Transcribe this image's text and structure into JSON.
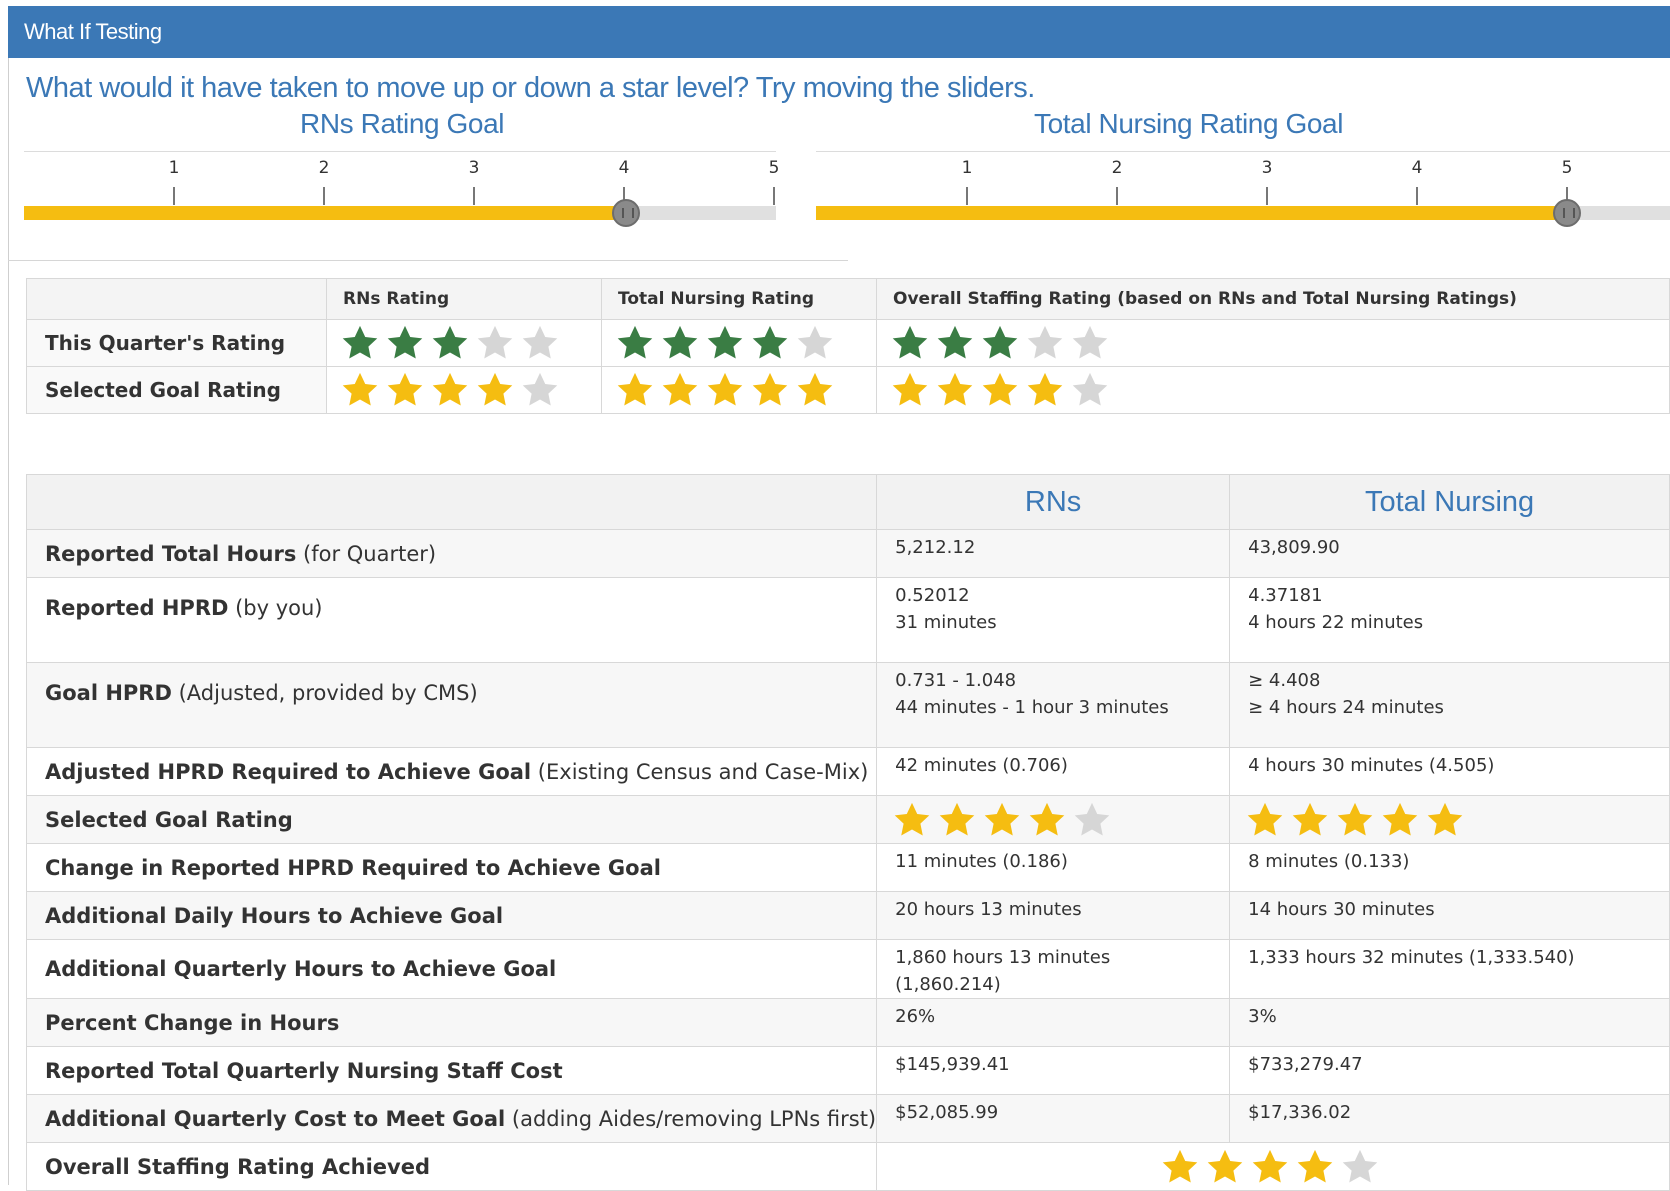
{
  "header": {
    "title": "What If Testing"
  },
  "question": "What would it have taken to move up or down a star level? Try moving the sliders.",
  "sliders": [
    {
      "title": "RNs Rating Goal",
      "ticks": [
        "1",
        "2",
        "3",
        "4",
        "5"
      ],
      "value": 4
    },
    {
      "title": "Total Nursing Rating Goal",
      "ticks": [
        "1",
        "2",
        "3",
        "4",
        "5"
      ],
      "value": 5
    }
  ],
  "ratings_table": {
    "headers": [
      "",
      "RNs Rating",
      "Total Nursing Rating",
      "Overall Staffing Rating (based on RNs and Total Nursing Ratings)"
    ],
    "rows": [
      {
        "label": "This Quarter's Rating",
        "stars": [
          3,
          4,
          3
        ],
        "color": "green"
      },
      {
        "label": "Selected Goal Rating",
        "stars": [
          4,
          5,
          4
        ],
        "color": "gold"
      }
    ]
  },
  "details_table": {
    "col_rns": "RNs",
    "col_total": "Total Nursing",
    "rows": [
      {
        "label_bold": "Reported Total Hours",
        "label_rest": " (for Quarter)",
        "rns": [
          "5,212.12"
        ],
        "total": [
          "43,809.90"
        ]
      },
      {
        "label_bold": "Reported HPRD",
        "label_rest": " (by you)",
        "rns": [
          "0.52012",
          "31 minutes"
        ],
        "total": [
          "4.37181",
          "4 hours 22 minutes"
        ]
      },
      {
        "label_bold": "Goal HPRD",
        "label_rest": " (Adjusted, provided by CMS)",
        "rns": [
          "0.731 - 1.048",
          "44 minutes - 1 hour 3 minutes"
        ],
        "total": [
          "≥ 4.408",
          "≥ 4 hours 24 minutes"
        ]
      },
      {
        "label_bold": "Adjusted HPRD Required to Achieve Goal",
        "label_rest": " (Existing Census and Case-Mix)",
        "rns": [
          "42 minutes (0.706)"
        ],
        "total": [
          "4 hours 30 minutes (4.505)"
        ]
      },
      {
        "label_bold": "Selected Goal Rating",
        "label_rest": "",
        "rns_stars": 4,
        "total_stars": 5
      },
      {
        "label_bold": "Change in Reported HPRD Required to Achieve Goal",
        "label_rest": "",
        "rns": [
          "11 minutes (0.186)"
        ],
        "total": [
          "8 minutes (0.133)"
        ]
      },
      {
        "label_bold": "Additional Daily Hours to Achieve Goal",
        "label_rest": "",
        "rns": [
          "20 hours 13 minutes"
        ],
        "total": [
          "14 hours 30 minutes"
        ]
      },
      {
        "label_bold": "Additional Quarterly Hours to Achieve Goal",
        "label_rest": "",
        "rns": [
          "1,860 hours 13 minutes (1,860.214)"
        ],
        "total": [
          "1,333 hours 32 minutes (1,333.540)"
        ]
      },
      {
        "label_bold": "Percent Change in Hours",
        "label_rest": "",
        "rns": [
          "26%"
        ],
        "total": [
          "3%"
        ]
      },
      {
        "label_bold": "Reported Total Quarterly Nursing Staff Cost",
        "label_rest": "",
        "rns": [
          "$145,939.41"
        ],
        "total": [
          "$733,279.47"
        ]
      },
      {
        "label_bold": "Additional Quarterly Cost to Meet Goal",
        "label_rest": " (adding Aides/removing LPNs first)",
        "rns": [
          "$52,085.99"
        ],
        "total": [
          "$17,336.02"
        ]
      },
      {
        "label_bold": "Overall Staffing Rating Achieved",
        "label_rest": "",
        "overall_stars": 4
      }
    ]
  },
  "colors": {
    "header_blue": "#3b78b6",
    "gold": "#f5bd11",
    "green": "#3a7d44",
    "empty_star": "#d6d6d6"
  }
}
